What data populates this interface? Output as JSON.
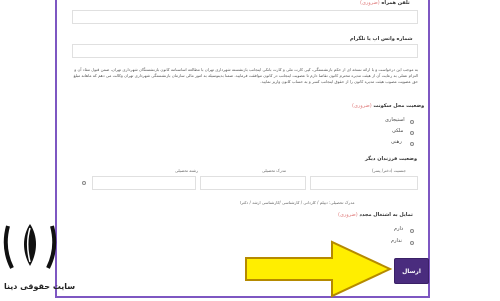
{
  "form": {
    "phone_label": "تلفن همراه",
    "phone_required": "(ضروری)",
    "whatsapp_label": "شماره واتس اپ یا تلگرام",
    "terms_text": "به موجب این درخواست و با ارائه نسخه ای از حکم بازنشستگی، کپی کارت ملی و کارت بانکی اینجانب بازنشسته شهرداری تهران با مطالعه اساسنامه کانون بازنشستگان شهرداری تهران، ضمن قبول مفاد آن و التزام عملی به رعایت آن از هیئت مدیره محترم کانون تقاضا دارم تا عضویت اینجانب در کانون موافقت فرمایید. ضمنا بدینوسیله به امور مالی سازمان بازنشستگی شهرداری تهران وکالت می دهم که ماهانه مبلغ حق عضویت مصوب هیئت مدیره کانون را از حقوق اینجانب کسر و به حساب کانون واریز نمایید.",
    "housing_label": "وضعیت محل سکونت",
    "housing_required": "(ضروری)",
    "housing_options": [
      "استیجاری",
      "ملکی",
      "رهنی"
    ],
    "children_label": "وضعیت فرزندان دیگر",
    "children_columns": [
      "جنسیت (دختر/ پسر)",
      "مدرک تحصیلی",
      "رشته تحصیلی"
    ],
    "education_hint": "مدرک تحصیلی: دیپلم / کاردانی / کارشناسی /کارشناسی ارشد / دکترا",
    "employment_label": "تمایل به اشتغال مجدد",
    "employment_required": "(ضروری)",
    "employment_options": [
      "دارم",
      "ندارم"
    ],
    "submit_label": "ارسال"
  },
  "branding": {
    "site_name": "سایت حقوقی دینا"
  },
  "colors": {
    "accent": "#7e57c2",
    "submit_bg": "#4a2c7e",
    "arrow_fill": "#ffee00",
    "arrow_stroke": "#b58a00",
    "required": "#e07c7c"
  }
}
